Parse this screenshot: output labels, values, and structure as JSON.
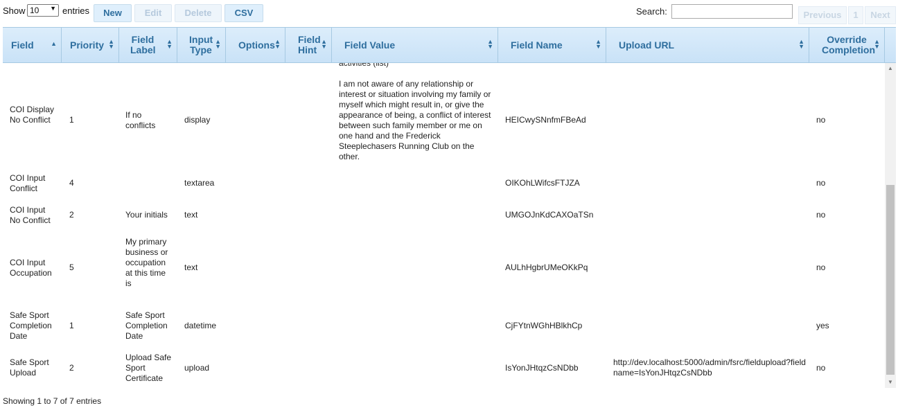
{
  "controls": {
    "show_label": "Show",
    "entries_value": "10",
    "entries_label": "entries",
    "new_label": "New",
    "edit_label": "Edit",
    "delete_label": "Delete",
    "csv_label": "CSV",
    "search_label": "Search:",
    "search_value": ""
  },
  "pager": {
    "previous": "Previous",
    "page": "1",
    "next": "Next"
  },
  "columns": {
    "field": "Field",
    "priority": "Priority",
    "field_label": "Field Label",
    "input_type": "Input Type",
    "options": "Options",
    "field_hint": "Field Hint",
    "field_value": "Field Value",
    "field_name": "Field Name",
    "upload_url": "Upload URL",
    "override_completion": "Override Completion"
  },
  "partial_value": "activities (list)",
  "rows": [
    {
      "field": "COI Display No Conflict",
      "priority": "1",
      "label": "If no conflicts",
      "input_type": "display",
      "options": "",
      "hint": "",
      "value": "I am not aware of any relationship or interest or situation involving my family or myself which might result in, or give the appearance of being, a conflict of interest between such family member or me on one hand and the Frederick Steeplechasers Running Club on the other.",
      "name": "HEICwySNnfmFBeAd",
      "url": "",
      "override": "no"
    },
    {
      "field": "COI Input Conflict",
      "priority": "4",
      "label": "",
      "input_type": "textarea",
      "options": "",
      "hint": "",
      "value": "",
      "name": "OIKOhLWifcsFTJZA",
      "url": "",
      "override": "no"
    },
    {
      "field": "COI Input No Conflict",
      "priority": "2",
      "label": "Your initials",
      "input_type": "text",
      "options": "",
      "hint": "",
      "value": "",
      "name": "UMGOJnKdCAXOaTSn",
      "url": "",
      "override": "no"
    },
    {
      "field": "COI Input Occupation",
      "priority": "5",
      "label": "My primary business or occupation at this time is",
      "input_type": "text",
      "options": "",
      "hint": "",
      "value": "",
      "name": "AULhHgbrUMeOKkPq",
      "url": "",
      "override": "no"
    },
    {
      "field": "Safe Sport Completion Date",
      "priority": "1",
      "label": "Safe Sport Completion Date",
      "input_type": "datetime",
      "options": "",
      "hint": "",
      "value": "",
      "name": "CjFYtnWGhHBlkhCp",
      "url": "",
      "override": "yes"
    },
    {
      "field": "Safe Sport Upload",
      "priority": "2",
      "label": "Upload Safe Sport Certificate",
      "input_type": "upload",
      "options": "",
      "hint": "",
      "value": "",
      "name": "IsYonJHtqzCsNDbb",
      "url": "http://dev.localhost:5000/admin/fsrc/fieldupload?fieldname=IsYonJHtqzCsNDbb",
      "override": "no"
    }
  ],
  "info": "Showing 1 to 7 of 7 entries"
}
